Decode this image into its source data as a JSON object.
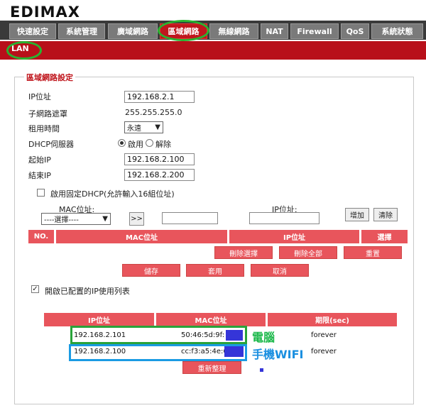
{
  "brand": {
    "logo": "EDIMAX"
  },
  "tabs": [
    {
      "label": "快速設定"
    },
    {
      "label": "系統管理"
    },
    {
      "label": "廣域網路"
    },
    {
      "label": "區域網路"
    },
    {
      "label": "無線網路"
    },
    {
      "label": "NAT"
    },
    {
      "label": "Firewall"
    },
    {
      "label": "QoS"
    },
    {
      "label": "系統狀態"
    }
  ],
  "subtab": "LAN",
  "section_title": "區域網路設定",
  "form": {
    "ip_label": "IP位址",
    "ip_value": "192.168.2.1",
    "mask_label": "子網路遮罩",
    "mask_value": "255.255.255.0",
    "lease_label": "租用時間",
    "lease_value": "永遠",
    "dhcp_label": "DHCP伺服器",
    "dhcp_on": "啟用",
    "dhcp_off": "解除",
    "start_label": "起始IP",
    "start_value": "192.168.2.100",
    "end_label": "結束IP",
    "end_value": "192.168.2.200"
  },
  "static_dhcp": {
    "checkbox_label": "啟用固定DHCP(允許輸入16組位址)",
    "mac_label": "MAC位址:",
    "select_value": "----選擇----",
    "arrow_btn": ">>",
    "ip_label": "IP位址:",
    "add_btn": "增加",
    "clear_btn": "清除",
    "headers": [
      "NO.",
      "MAC位址",
      "IP位址",
      "選擇"
    ],
    "delete_selected": "刪除選擇",
    "delete_all": "刪除全部",
    "reset": "重置"
  },
  "actions": {
    "save": "儲存",
    "apply": "套用",
    "cancel": "取消"
  },
  "lease_table": {
    "checkbox_label": "開啟已配置的IP使用列表",
    "headers": [
      "IP位址",
      "MAC位址",
      "期限(sec)"
    ],
    "rows": [
      {
        "ip": "192.168.2.101",
        "mac": "50:46:5d:9f:",
        "expiry": "forever",
        "note": "電腦"
      },
      {
        "ip": "192.168.2.100",
        "mac": "cc:f3:a5:4e:6",
        "expiry": "forever",
        "note": "手機WIFI"
      }
    ],
    "refresh": "重新整理"
  },
  "colors": {
    "accent": "#c0161d",
    "header_red": "#e8555c",
    "annotation_green": "#29b331",
    "annotation_blue": "#1a8fe0"
  }
}
